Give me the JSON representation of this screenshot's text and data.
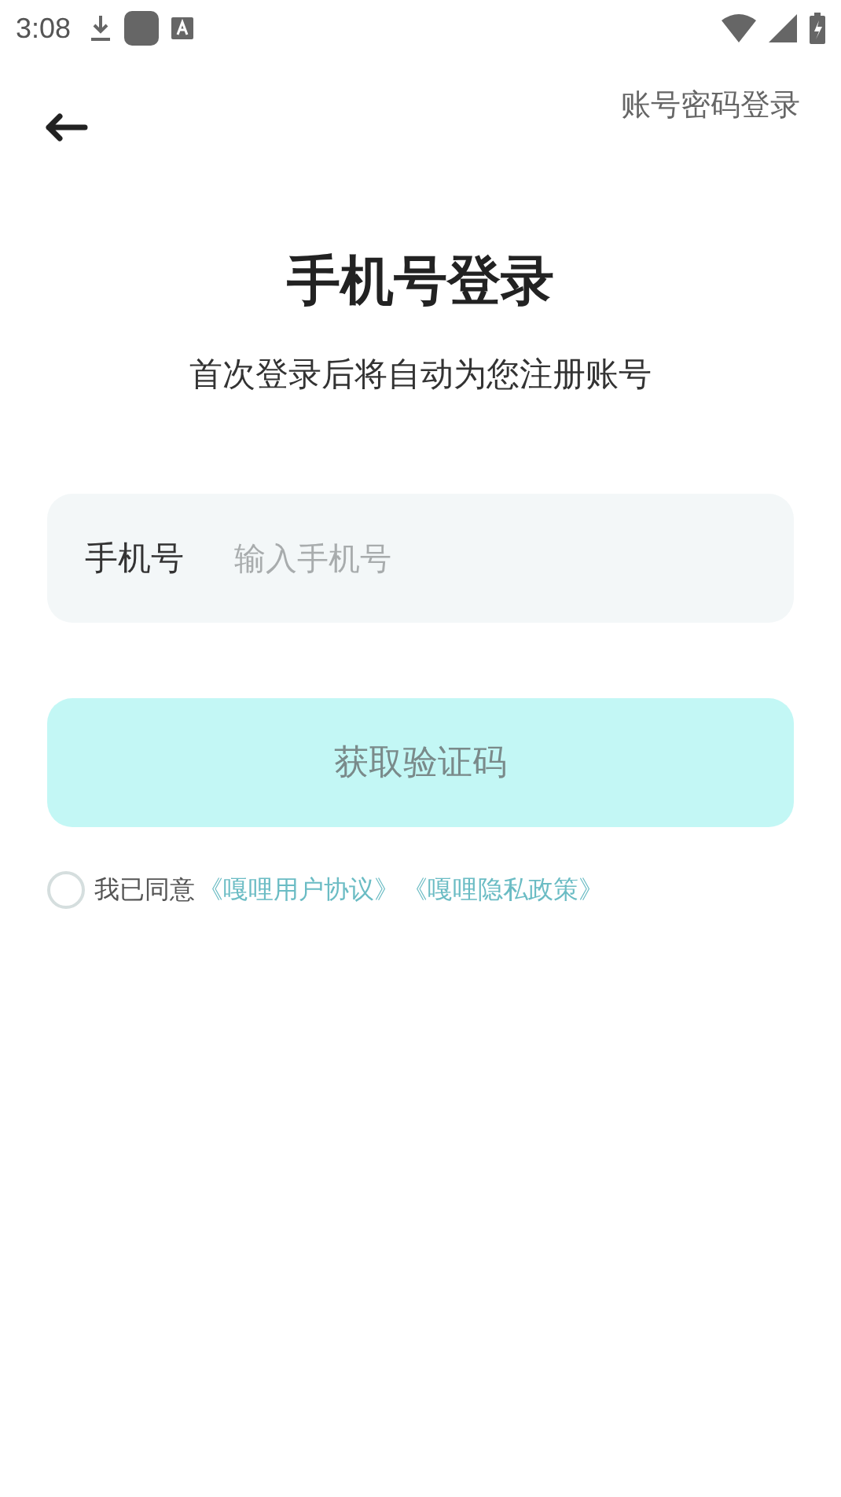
{
  "status_bar": {
    "time": "3:08"
  },
  "header": {
    "switch_link": "账号密码登录"
  },
  "title": "手机号登录",
  "subtitle": "首次登录后将自动为您注册账号",
  "phone_field": {
    "label": "手机号",
    "placeholder": "输入手机号"
  },
  "submit_button": {
    "label": "获取验证码",
    "disabled": true
  },
  "agreement": {
    "checked": false,
    "text": "我已同意",
    "links": [
      "《嘎哩用户协议》",
      "《嘎哩隐私政策》"
    ]
  }
}
